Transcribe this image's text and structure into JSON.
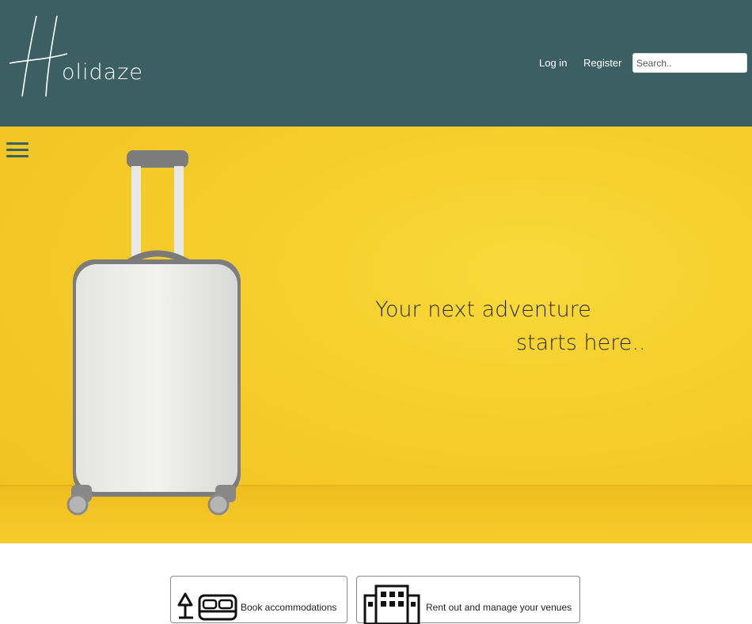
{
  "header": {
    "logo_text": "olidaze",
    "nav": {
      "login": "Log in",
      "register": "Register"
    },
    "search": {
      "placeholder": "Search..",
      "value": ""
    }
  },
  "hero": {
    "tagline_line1": "Your next adventure",
    "tagline_line2": "starts here..",
    "menu_icon": "hamburger-menu-icon"
  },
  "cards": [
    {
      "label": "Book accommodations",
      "icon": "bed-lamp-icon"
    },
    {
      "label": "Rent out and manage your venues",
      "icon": "building-icon"
    }
  ],
  "colors": {
    "header_bg": "#3b5f63",
    "hero_bg": "#f5cc2a",
    "text_dark": "#2b2b2b"
  }
}
